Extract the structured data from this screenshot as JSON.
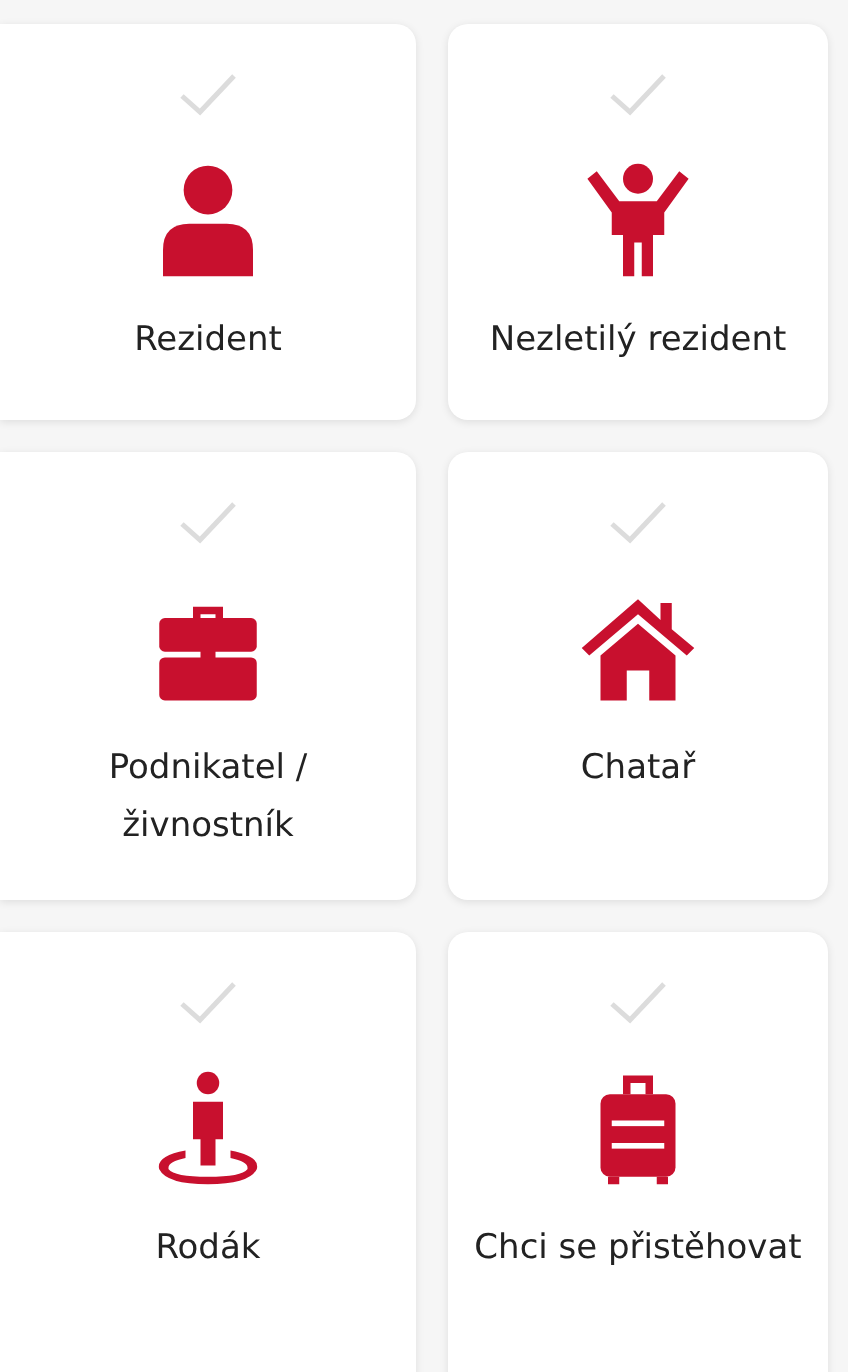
{
  "cards": [
    {
      "kind": "person",
      "label": "Rezident",
      "selected": false
    },
    {
      "kind": "child",
      "label": "Nezletilý rezident",
      "selected": false
    },
    {
      "kind": "briefcase",
      "label": "Podnikatel / živnostník",
      "selected": false
    },
    {
      "kind": "house",
      "label": "Chatař",
      "selected": false
    },
    {
      "kind": "local",
      "label": "Rodák",
      "selected": false
    },
    {
      "kind": "suitcase",
      "label": "Chci se přistěhovat",
      "selected": false
    }
  ]
}
